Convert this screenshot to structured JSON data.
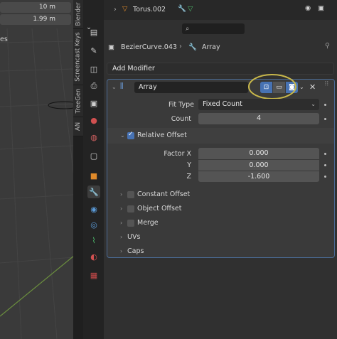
{
  "viewport": {
    "fields": [
      "10 m",
      "1.99 m"
    ],
    "side_label": "es"
  },
  "vertical_tabs": [
    "Blender",
    "Screencast Keys",
    "TreeGen",
    "AN"
  ],
  "outliner": {
    "item_label": "Torus.002"
  },
  "properties": {
    "search_placeholder": "",
    "breadcrumb": {
      "object": "BezierCurve.043",
      "modifier": "Array"
    },
    "add_modifier_label": "Add Modifier",
    "modifier": {
      "name": "Array",
      "fit_type_label": "Fit Type",
      "fit_type_value": "Fixed Count",
      "count_label": "Count",
      "count_value": "4",
      "relative_offset": {
        "label": "Relative Offset",
        "checked": true,
        "factor_x_label": "Factor X",
        "factor_x": "0.000",
        "y_label": "Y",
        "y": "0.000",
        "z_label": "Z",
        "z": "-1.600"
      },
      "constant_offset_label": "Constant Offset",
      "object_offset_label": "Object Offset",
      "merge_label": "Merge",
      "uvs_label": "UVs",
      "caps_label": "Caps"
    },
    "colors": {
      "accent": "#4772b3",
      "highlight_circle": "#c9b84a"
    }
  }
}
